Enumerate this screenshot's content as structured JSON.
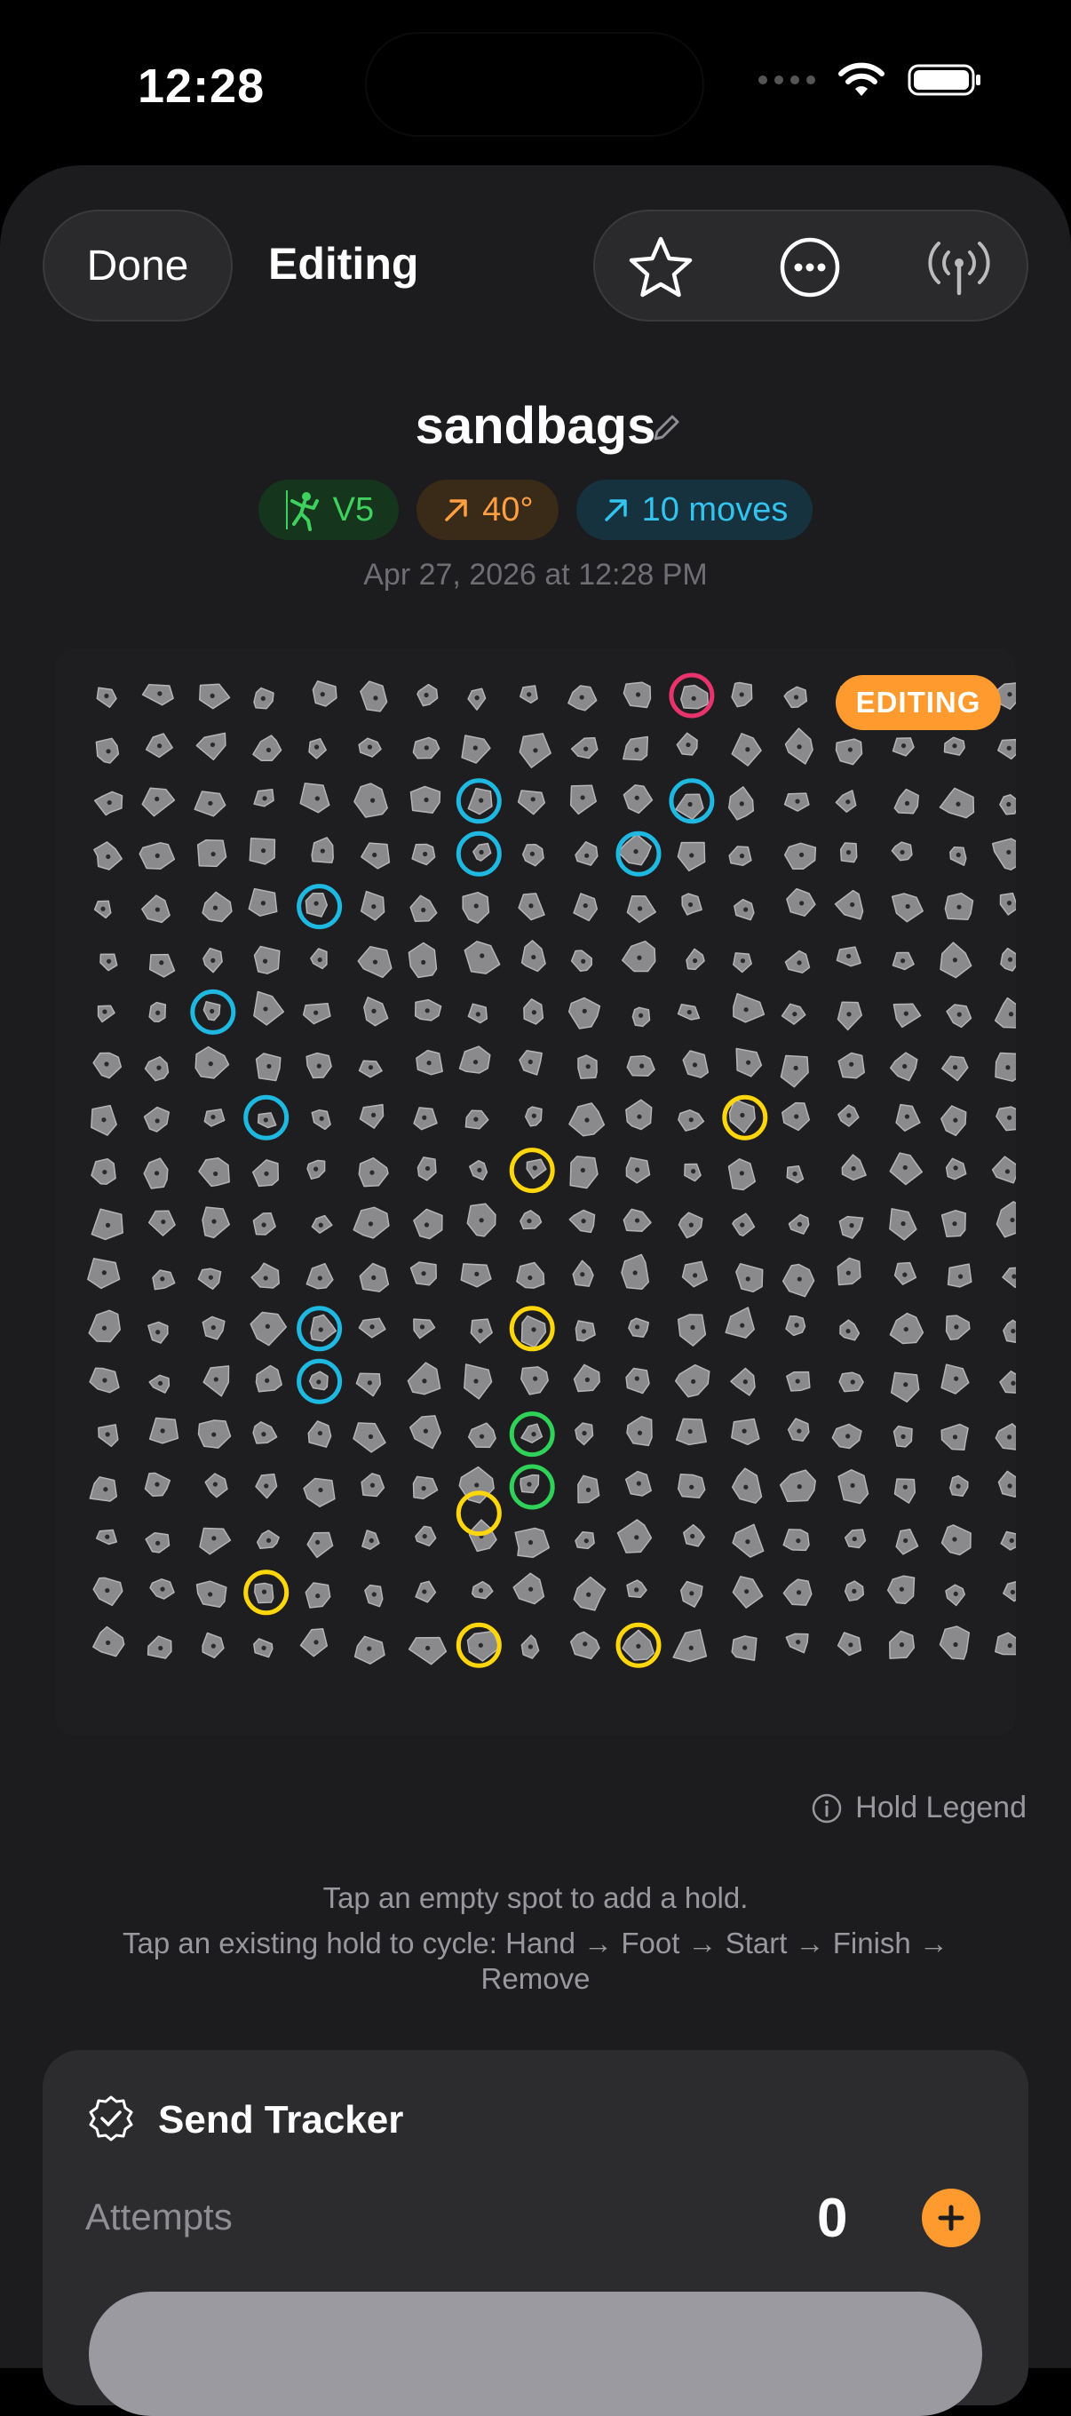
{
  "status": {
    "time": "12:28"
  },
  "header": {
    "done_label": "Done",
    "title": "Editing"
  },
  "route": {
    "name": "sandbags",
    "grade": "V5",
    "angle": "40°",
    "moves": "10 moves",
    "date": "Apr 27, 2026 at 12:28 PM"
  },
  "board": {
    "badge": "EDITING",
    "colors": {
      "start": "#30d158",
      "hand": "#1fb8e0",
      "foot": "#ffd60a",
      "finish": "#e8336d"
    },
    "grid": {
      "cols": 18,
      "rows": 19
    },
    "marked_holds": [
      {
        "col": 11,
        "row": 0,
        "type": "finish"
      },
      {
        "col": 7,
        "row": 2,
        "type": "hand"
      },
      {
        "col": 11,
        "row": 2,
        "type": "hand"
      },
      {
        "col": 7,
        "row": 3,
        "type": "hand"
      },
      {
        "col": 10,
        "row": 3,
        "type": "hand"
      },
      {
        "col": 4,
        "row": 4,
        "type": "hand"
      },
      {
        "col": 2,
        "row": 6,
        "type": "hand"
      },
      {
        "col": 3,
        "row": 8,
        "type": "hand"
      },
      {
        "col": 12,
        "row": 8,
        "type": "foot"
      },
      {
        "col": 8,
        "row": 9,
        "type": "foot"
      },
      {
        "col": 4,
        "row": 12,
        "type": "hand"
      },
      {
        "col": 8,
        "row": 12,
        "type": "foot"
      },
      {
        "col": 4,
        "row": 13,
        "type": "hand"
      },
      {
        "col": 8,
        "row": 14,
        "type": "start"
      },
      {
        "col": 8,
        "row": 15,
        "type": "start"
      },
      {
        "col": 7,
        "row": 15.5,
        "type": "foot"
      },
      {
        "col": 3,
        "row": 17,
        "type": "foot"
      },
      {
        "col": 7,
        "row": 18,
        "type": "foot"
      },
      {
        "col": 10,
        "row": 18,
        "type": "foot"
      }
    ]
  },
  "legend_label": "Hold Legend",
  "help": {
    "line1": "Tap an empty spot to add a hold.",
    "line2": "Tap an existing hold to cycle:  Hand → Foot → Start → Finish → Remove"
  },
  "tracker": {
    "title": "Send Tracker",
    "attempts_label": "Attempts",
    "attempts_value": "0"
  },
  "icons": [
    "wifi-icon",
    "battery-icon",
    "star-icon",
    "more-icon",
    "broadcast-icon",
    "pencil-icon",
    "climber-icon",
    "arrow-up-right-icon",
    "info-icon",
    "check-badge-icon",
    "plus-icon"
  ]
}
